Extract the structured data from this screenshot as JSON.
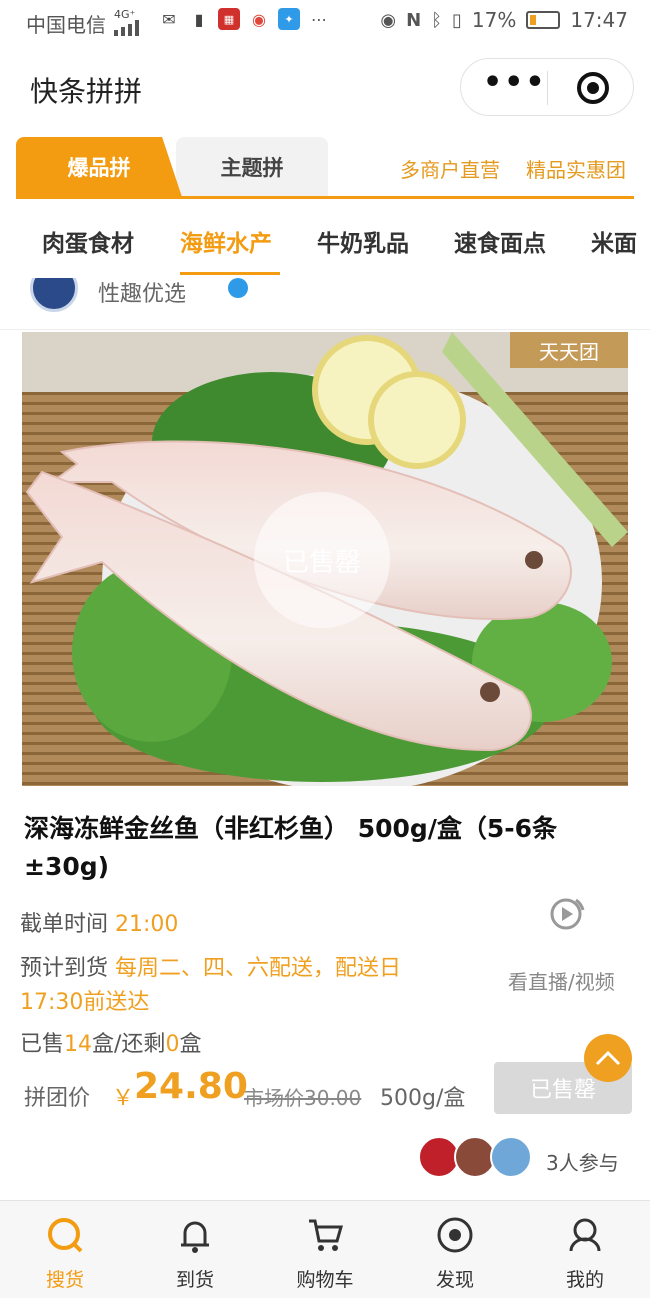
{
  "status_bar": {
    "carrier": "中国电信",
    "network": "4G⁺",
    "battery": "17%",
    "time": "17:47",
    "icons": [
      "wechat-icon",
      "alert-icon",
      "netease-icon",
      "weibo-icon",
      "bulb-icon",
      "more-icon",
      "eye-icon",
      "nfc-icon",
      "bluetooth-icon",
      "vibrate-icon"
    ]
  },
  "app": {
    "title": "快条拼拼",
    "menu_icon": "more-dots-icon",
    "close_icon": "target-icon"
  },
  "main_tabs": [
    {
      "label": "爆品拼",
      "active": true
    },
    {
      "label": "主题拼",
      "active": false
    }
  ],
  "tab_links": [
    "多商户直营",
    "精品实惠团"
  ],
  "categories": [
    "肉蛋食材",
    "海鲜水产",
    "牛奶乳品",
    "速食面点",
    "米面"
  ],
  "active_category": "海鲜水产",
  "store": {
    "name": "性趣优选"
  },
  "product": {
    "tag": "天天团",
    "overlay": "已售罄",
    "title": "深海冻鲜金丝鱼（非红杉鱼） 500g/盒（5-6条±30g)",
    "cutoff_label": "截单时间",
    "cutoff_value": "21:00",
    "arrival_label": "预计到货",
    "arrival_value_line1": "每周二、四、六配送，配送日",
    "arrival_value_line2": "17:30前送达",
    "sold_prefix": "已售",
    "sold_count": "14",
    "sold_mid": "盒/还剩",
    "remaining": "0",
    "sold_suffix": "盒",
    "live_label": "看直播/视频",
    "price_label": "拼团价",
    "currency": "￥",
    "price": "24.80",
    "market_price": "市场价30.00",
    "unit": "500g/盒",
    "button": "已售罄",
    "participants": "3人参与"
  },
  "colors": {
    "accent": "#f39c12",
    "highlight": "#f0a020"
  },
  "bottom_tabs": [
    {
      "label": "搜货",
      "icon": "search-icon",
      "active": true
    },
    {
      "label": "到货",
      "icon": "bell-icon",
      "active": false
    },
    {
      "label": "购物车",
      "icon": "cart-icon",
      "active": false
    },
    {
      "label": "发现",
      "icon": "discover-icon",
      "active": false
    },
    {
      "label": "我的",
      "icon": "profile-icon",
      "active": false
    }
  ]
}
